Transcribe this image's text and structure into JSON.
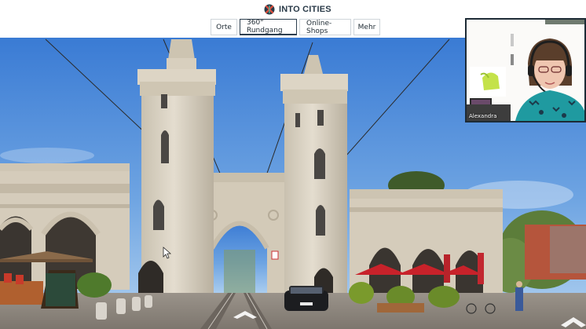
{
  "brand": {
    "name": "INTO CITIES"
  },
  "nav": {
    "tabs": [
      {
        "label": "Orte",
        "active": false
      },
      {
        "label": "360° Rundgang",
        "active": true
      },
      {
        "label": "Online-Shops",
        "active": false
      },
      {
        "label": "Mehr",
        "active": false
      }
    ]
  },
  "video": {
    "participant_name": "Alexandra"
  },
  "panorama": {
    "sign_text": ""
  },
  "colors": {
    "sky_top": "#3d7fd6",
    "sky_bottom": "#a9cdf0",
    "stone": "#d9d1c1",
    "umbrella": "#d8232a",
    "header_text": "#2a3a48",
    "tab_border": "#cfd5da"
  },
  "icons": [
    "logo-icon",
    "forward-arrow-icon",
    "mouse-cursor-icon",
    "headset-icon"
  ]
}
